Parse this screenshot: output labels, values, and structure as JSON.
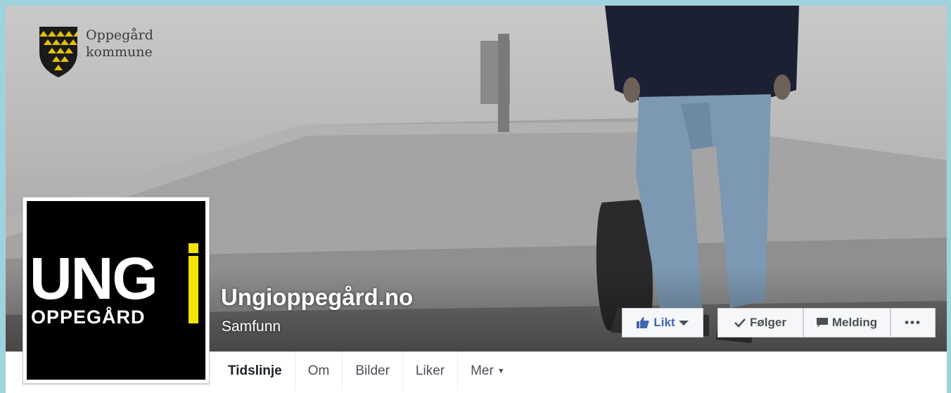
{
  "municipality": {
    "name_line1": "Oppegård",
    "name_line2": "kommune"
  },
  "profile": {
    "logo_line1": "UNG",
    "logo_line2": "OPPEGÅRD",
    "accent_color": "#f2e600"
  },
  "page": {
    "name": "Ungioppegård.no",
    "category": "Samfunn"
  },
  "actions": {
    "like_label": "Likt",
    "follow_label": "Følger",
    "message_label": "Melding",
    "more_label": "•••"
  },
  "tabs": [
    {
      "label": "Tidslinje"
    },
    {
      "label": "Om"
    },
    {
      "label": "Bilder"
    },
    {
      "label": "Liker"
    },
    {
      "label": "Mer"
    }
  ],
  "colors": {
    "frame": "#9ed3dd",
    "facebook_blue": "#4267b2"
  }
}
